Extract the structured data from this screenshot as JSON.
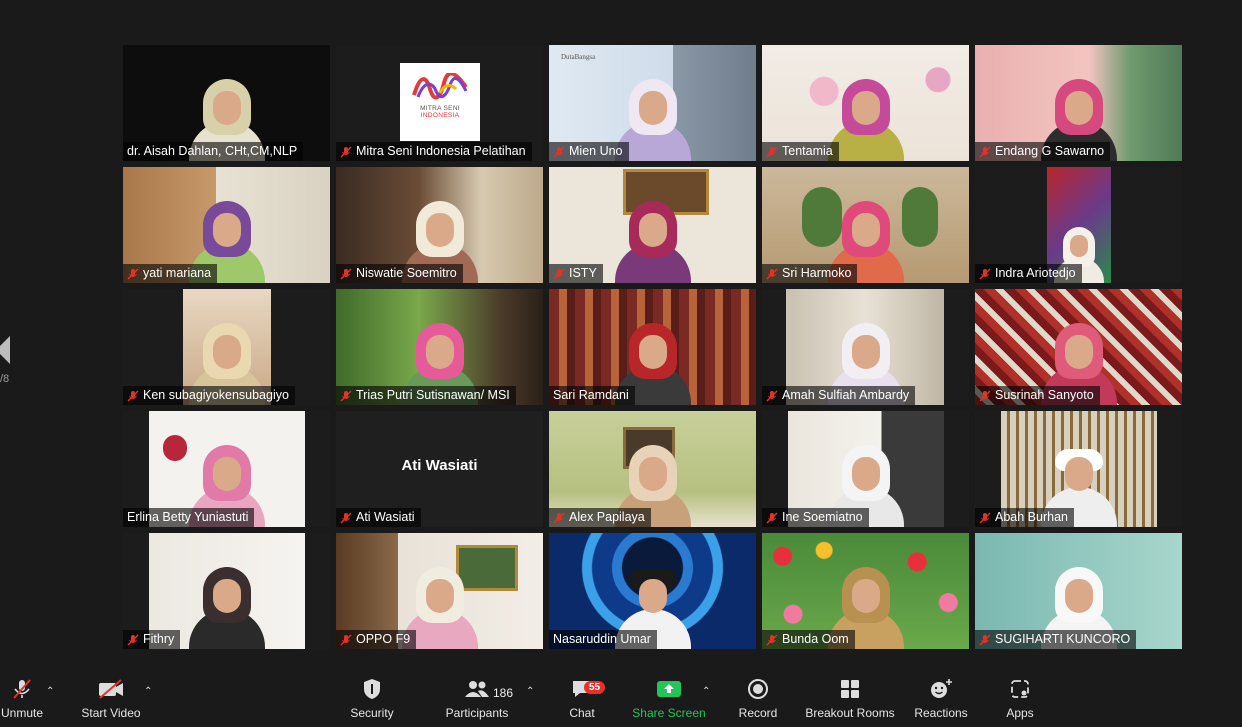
{
  "meeting": {
    "page_indicator": "/8",
    "participants_count": "186",
    "chat_badge": "55"
  },
  "brand": {
    "watermark": "DutaBangsa",
    "logo_line1": "MITRA SENI",
    "logo_line2": "INDONESIA"
  },
  "tiles": [
    {
      "name": "dr. Aisah Dahlan, CHt,CM,NLP",
      "muted": false
    },
    {
      "name": "Mitra Seni Indonesia Pelatihan",
      "muted": true
    },
    {
      "name": "Mien Uno",
      "muted": true
    },
    {
      "name": "Tentamia",
      "muted": true
    },
    {
      "name": "Endang G Sawarno",
      "muted": true
    },
    {
      "name": "yati mariana",
      "muted": true
    },
    {
      "name": "Niswatie Soemitro",
      "muted": true
    },
    {
      "name": "ISTY",
      "muted": true
    },
    {
      "name": "Sri Harmoko",
      "muted": true
    },
    {
      "name": "Indra Ariotedjo",
      "muted": true
    },
    {
      "name": "Ken subagiyokensubagiyo",
      "muted": true
    },
    {
      "name": "Trias Putri Sutisnawan/ MSI",
      "muted": true
    },
    {
      "name": "Sari Ramdani",
      "muted": false
    },
    {
      "name": "Amah Sulfiah Ambardy",
      "muted": true
    },
    {
      "name": "Susrinah Sanyoto",
      "muted": true
    },
    {
      "name": "Erlina Betty Yuniastuti",
      "muted": false
    },
    {
      "name": "Ati Wasiati",
      "muted": true,
      "center_label": "Ati Wasiati"
    },
    {
      "name": "Alex Papilaya",
      "muted": true
    },
    {
      "name": "Ine Soemiatno",
      "muted": true
    },
    {
      "name": "Abah Burhan",
      "muted": true
    },
    {
      "name": "Fithry",
      "muted": true
    },
    {
      "name": "OPPO F9",
      "muted": true
    },
    {
      "name": "Nasaruddin Umar",
      "muted": false,
      "active": true
    },
    {
      "name": "Bunda Oom",
      "muted": true
    },
    {
      "name": "SUGIHARTI KUNCORO",
      "muted": true
    }
  ],
  "toolbar": {
    "unmute": "Unmute",
    "start_video": "Start Video",
    "security": "Security",
    "participants": "Participants",
    "chat": "Chat",
    "share_screen": "Share Screen",
    "record": "Record",
    "breakout_rooms": "Breakout Rooms",
    "reactions": "Reactions",
    "apps": "Apps"
  },
  "colors": {
    "background": "#1a1a1a",
    "active_speaker": "#f5e542",
    "mute_red": "#e5312b",
    "share_green": "#24c45a"
  }
}
